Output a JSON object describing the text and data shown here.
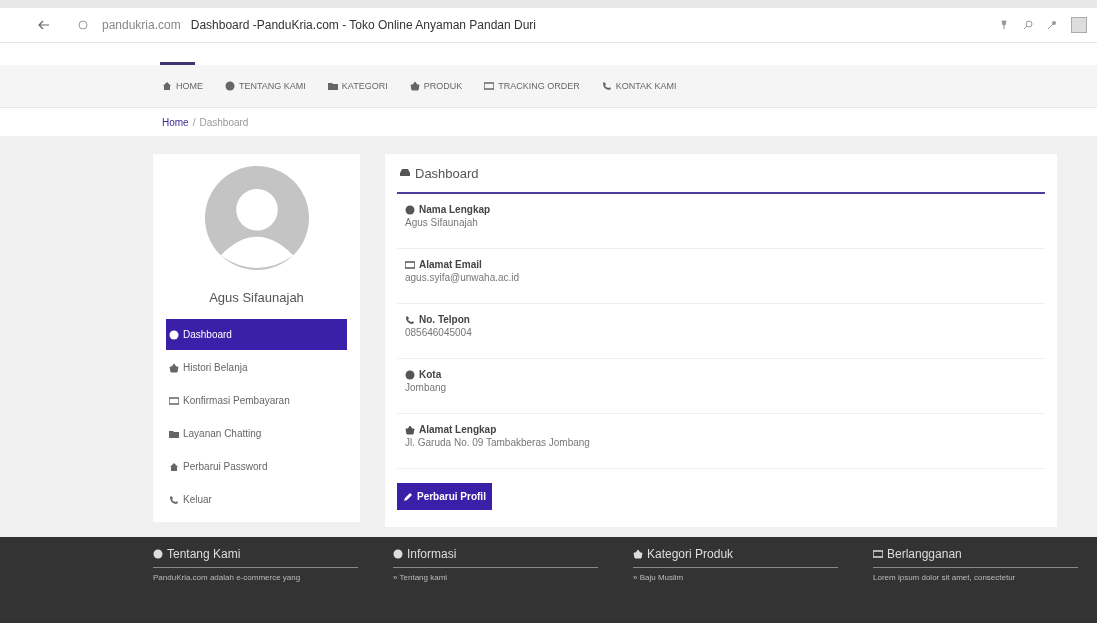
{
  "browser": {
    "domain": "pandukria.com",
    "title": "Dashboard -PanduKria.com - Toko Online Anyaman Pandan Duri"
  },
  "nav": [
    "HOME",
    "TENTANG KAMI",
    "KATEGORI",
    "PRODUK",
    "TRACKING ORDER",
    "KONTAK KAMI"
  ],
  "breadcrumb": {
    "home": "Home",
    "separator": "/",
    "current": "Dashboard"
  },
  "profile": {
    "name": "Agus Sifaunajah"
  },
  "menu": [
    {
      "label": "Dashboard",
      "selected": true
    },
    {
      "label": "Histori Belanja",
      "selected": false
    },
    {
      "label": "Konfirmasi Pembayaran",
      "selected": false
    },
    {
      "label": "Layanan Chatting",
      "selected": false
    },
    {
      "label": "Perbarui Password",
      "selected": false
    },
    {
      "label": "Keluar",
      "selected": false
    }
  ],
  "panel": {
    "title": "Dashboard",
    "fields": [
      {
        "label": "Nama Lengkap",
        "value": "Agus Sifaunajah"
      },
      {
        "label": "Alamat Email",
        "value": "agus.syifa@unwaha.ac.id"
      },
      {
        "label": "No. Telpon",
        "value": "085646045004"
      },
      {
        "label": "Kota",
        "value": "Jombang"
      },
      {
        "label": "Alamat Lengkap",
        "value": "Jl. Garuda No. 09 Tambakberas Jombang"
      }
    ],
    "button": "Perbarui Profil"
  },
  "footer": [
    {
      "title": "Tentang Kami",
      "text": "PanduKria.com adalah e-commerce yang"
    },
    {
      "title": "Informasi",
      "text": "» Tentang kami"
    },
    {
      "title": "Kategori Produk",
      "text": "» Baju Muslim"
    },
    {
      "title": "Berlangganan",
      "text": "Lorem ipsum dolor sit amet, consectetur"
    }
  ]
}
